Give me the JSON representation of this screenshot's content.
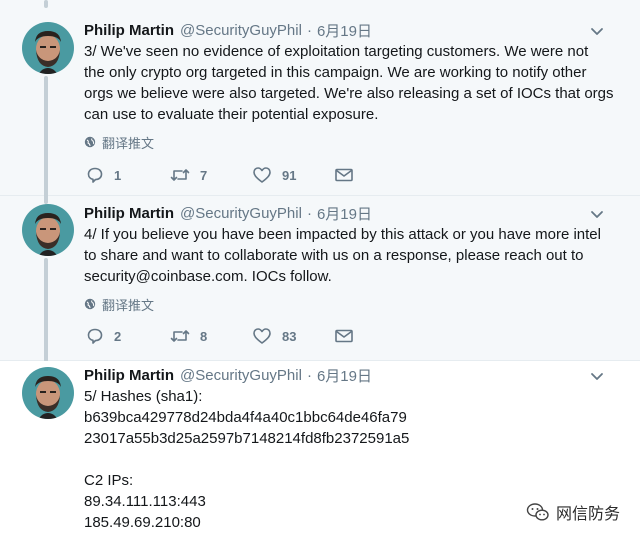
{
  "tweets": [
    {
      "name": "Philip Martin",
      "handle": "@SecurityGuyPhil",
      "separator": "·",
      "date": "6月19日",
      "text": "3/ We've seen no evidence of exploitation targeting customers.  We were not\nthe only crypto org targeted in this campaign. We are working to notify other\norgs we believe were also targeted. We're also releasing a set of IOCs that orgs\ncan use to evaluate their potential exposure.",
      "translate": "翻译推文",
      "replies": "1",
      "retweets": "7",
      "likes": "91"
    },
    {
      "name": "Philip Martin",
      "handle": "@SecurityGuyPhil",
      "separator": "·",
      "date": "6月19日",
      "text": "4/ If you believe you have been impacted by this attack or you have more intel\nto share and want to collaborate with us on a response, please reach out to\nsecurity@coinbase.com.  IOCs follow.",
      "translate": "翻译推文",
      "replies": "2",
      "retweets": "8",
      "likes": "83"
    },
    {
      "name": "Philip Martin",
      "handle": "@SecurityGuyPhil",
      "separator": "·",
      "date": "6月19日",
      "text": "5/ Hashes (sha1):\nb639bca429778d24bda4f4a40c1bbc64de46fa79\n23017a55b3d25a2597b7148214fd8fb2372591a5\n\nC2 IPs:\n89.34.111.113:443\n185.49.69.210:80"
    }
  ],
  "watermark": "网信防务",
  "colors": {
    "text": "#14171a",
    "secondary": "#657786",
    "thread_line": "#c4cfd6",
    "tweet_bg": "#f5f8fa"
  },
  "icons": [
    "avatar",
    "chevron-down-icon",
    "globe-icon",
    "reply-icon",
    "retweet-icon",
    "like-icon",
    "dm-icon",
    "wechat-icon"
  ]
}
